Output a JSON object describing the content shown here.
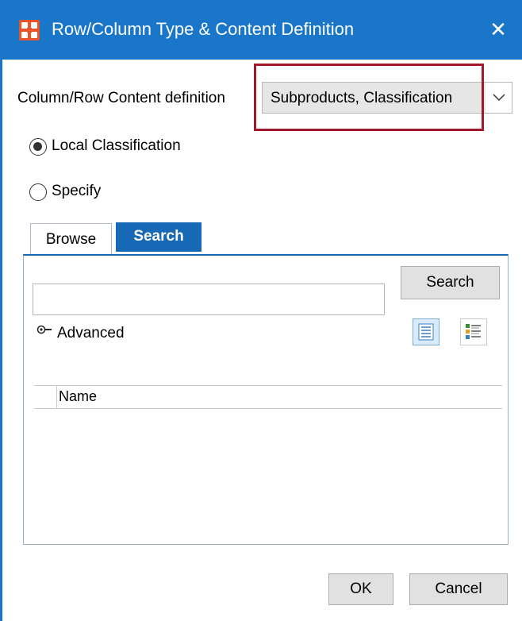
{
  "window": {
    "title": "Row/Column Type & Content Definition",
    "close_glyph": "✕"
  },
  "content_definition": {
    "label": "Column/Row Content definition",
    "selected_value": "Subproducts, Classification",
    "highlight_color": "#a0192a"
  },
  "radios": [
    {
      "label": "Local Classification",
      "checked": true
    },
    {
      "label": "Specify",
      "checked": false
    }
  ],
  "tabs": [
    {
      "label": "Browse",
      "active": false
    },
    {
      "label": "Search",
      "active": true
    }
  ],
  "search_panel": {
    "input_value": "",
    "search_button": "Search",
    "advanced_label": "Advanced",
    "view_icons": [
      "list-view-icon",
      "details-view-icon"
    ],
    "columns": [
      "Name"
    ]
  },
  "footer": {
    "ok_label": "OK",
    "cancel_label": "Cancel"
  },
  "colors": {
    "titlebar": "#1976c8",
    "active_tab": "#1769b6",
    "app_icon": "#e8532a"
  }
}
